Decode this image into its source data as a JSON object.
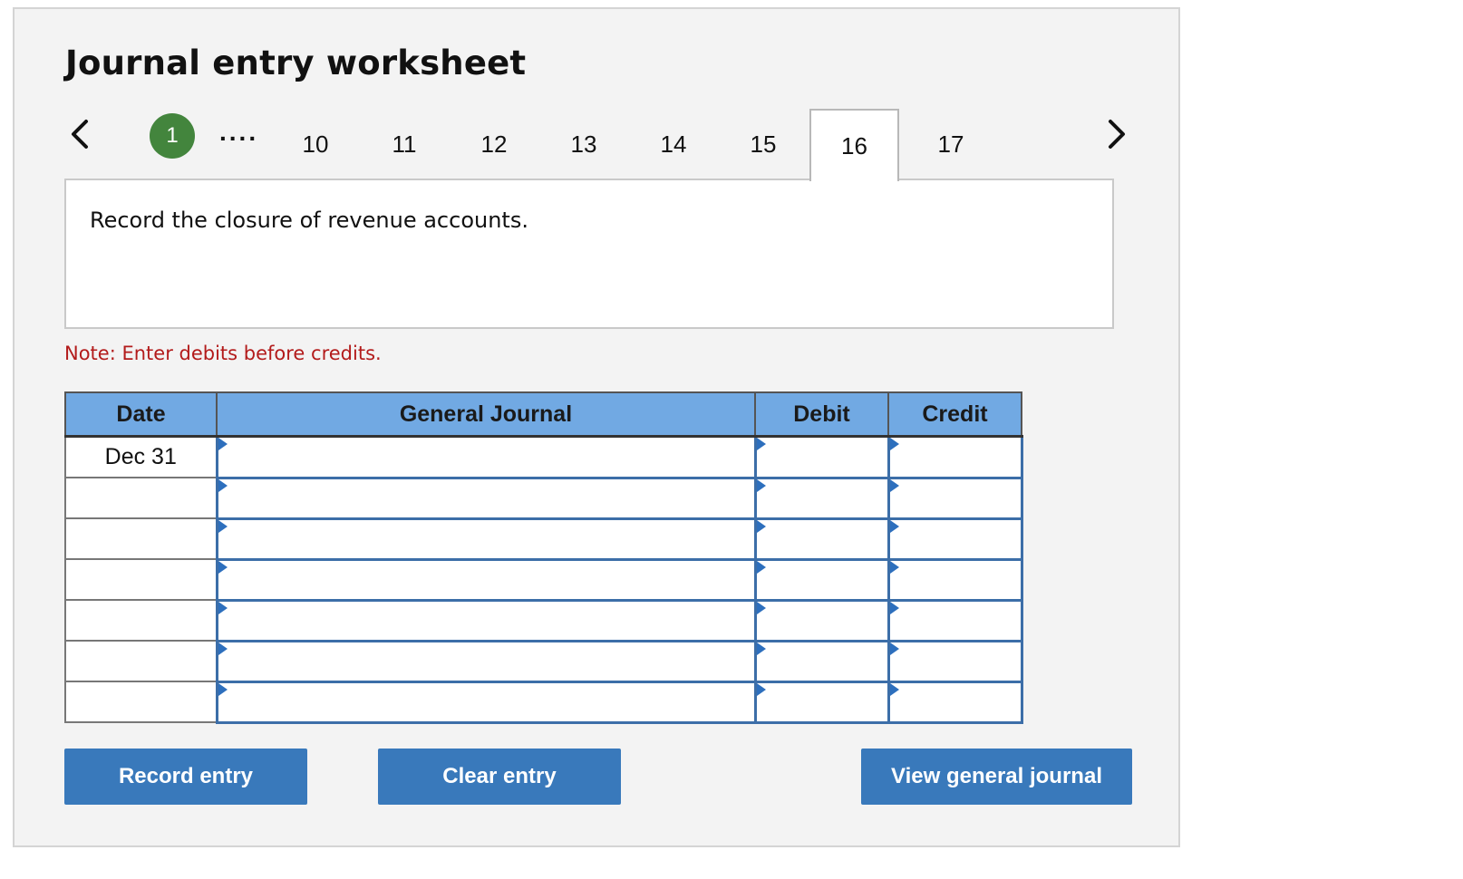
{
  "title": "Journal entry worksheet",
  "navigation": {
    "current_step": "1",
    "ellipsis": "....",
    "tabs": [
      {
        "label": "10"
      },
      {
        "label": "11"
      },
      {
        "label": "12"
      },
      {
        "label": "13"
      },
      {
        "label": "14"
      },
      {
        "label": "15"
      },
      {
        "label": "16",
        "active": true
      },
      {
        "label": "17"
      }
    ],
    "prev_icon": "chevron-left-icon",
    "next_icon": "chevron-right-icon"
  },
  "instructions": "Record the closure of revenue accounts.",
  "note": "Note: Enter debits before credits.",
  "table": {
    "headers": {
      "date": "Date",
      "general_journal": "General Journal",
      "debit": "Debit",
      "credit": "Credit"
    },
    "rows": [
      {
        "date": "Dec 31"
      },
      {
        "date": ""
      },
      {
        "date": ""
      },
      {
        "date": ""
      },
      {
        "date": ""
      },
      {
        "date": ""
      },
      {
        "date": ""
      }
    ]
  },
  "buttons": {
    "record": "Record entry",
    "clear": "Clear entry",
    "view": "View general journal"
  },
  "colors": {
    "panel_bg": "#f3f3f3",
    "header_bg": "#71a9e3",
    "button_bg": "#3979bb",
    "step_green": "#43853d",
    "note_red": "#b31b1b",
    "input_border": "#3c6ea8"
  }
}
